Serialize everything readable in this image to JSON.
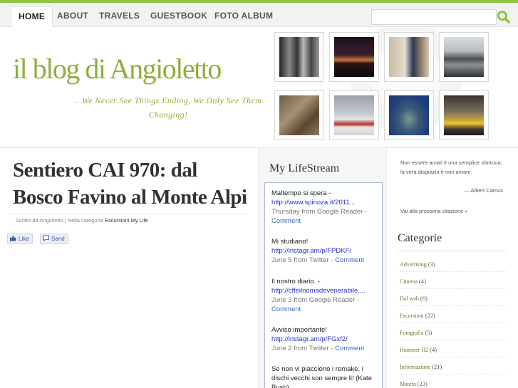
{
  "nav": {
    "items": [
      {
        "label": "HOME",
        "active": true
      },
      {
        "label": "ABOUT",
        "active": false
      },
      {
        "label": "TRAVELS",
        "active": false
      },
      {
        "label": "GUESTBOOK",
        "active": false
      },
      {
        "label": "FOTO ALBUM",
        "active": false
      }
    ],
    "search": {
      "value": "",
      "icon": "search-icon"
    }
  },
  "header": {
    "title": "il blog di Angioletto",
    "tagline": "...We Never See Things Ending, We Only See Them Changing!",
    "photos": [
      {
        "subject": "city-street-photo"
      },
      {
        "subject": "skyline-night-photo"
      },
      {
        "subject": "saxophone-player-photo"
      },
      {
        "subject": "bridge-photo"
      },
      {
        "subject": "squirrel-photo"
      },
      {
        "subject": "ice-skaters-photo"
      },
      {
        "subject": "statue-of-liberty-photo"
      },
      {
        "subject": "taxi-street-photo"
      }
    ]
  },
  "post": {
    "title": "Sentiero CAI 970: dal Bosco Favino al Monte Alpi",
    "meta_prefix": "Scritto da Angioletto | Nella categoria",
    "categories": "Escursioni  My Life",
    "like_label": "Like",
    "send_label": "Send"
  },
  "lifestream": {
    "title": "My LifeStream",
    "items": [
      {
        "text": "Maltempo si spera -",
        "link": "http://www.spinoza.it/2011...",
        "date": "Thursday from Google Reader -",
        "comment": "Comment"
      },
      {
        "text": "Mi studiano!",
        "link": "http://instagr.am/p/FPDKF/",
        "date": "June 5 from Twitter -",
        "comment": "Comment"
      },
      {
        "text": "Il nostro diario. -",
        "link": "http://cffeilnomadevenerabile....",
        "date": "June 3 from Google Reader -",
        "comment": "Comment"
      },
      {
        "text": "Avviso importante!",
        "link": "http://instagr.am/p/FGxf2/",
        "date": "June 2 from Twitter -",
        "comment": "Comment"
      },
      {
        "text": "Se non vi piacciono i remake, i dischi vecchi son sempre li! (Kate Bush)",
        "link": "",
        "date": "",
        "comment": ""
      }
    ]
  },
  "sidebar": {
    "quote": "Non essere amati è una semplice sfortuna; la vera disgrazia è non amare.",
    "quote_author": "— Albert Camus",
    "next_quote": "Vai alla prossima citazione »",
    "categories_title": "Categorie",
    "categories": [
      {
        "name": "Advertising",
        "count": "(3)"
      },
      {
        "name": "Cinema",
        "count": "(4)"
      },
      {
        "name": "Dal web",
        "count": "(6)"
      },
      {
        "name": "Escursioni",
        "count": "(22)"
      },
      {
        "name": "Fotografia",
        "count": "(5)"
      },
      {
        "name": "Hummer H2",
        "count": "(4)"
      },
      {
        "name": "Informazione",
        "count": "(21)"
      },
      {
        "name": "Matera",
        "count": "(23)"
      }
    ]
  },
  "colors": {
    "accent": "#8cb03c",
    "topline": "#8dc63f",
    "link": "#2233cc"
  }
}
